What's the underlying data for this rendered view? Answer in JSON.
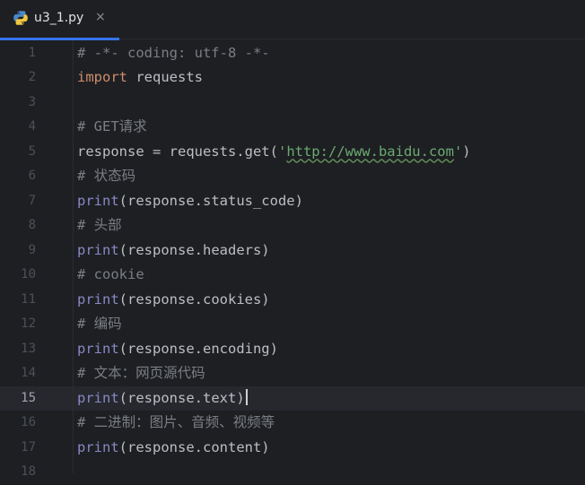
{
  "tab": {
    "label": "u3_1.py",
    "close": "×"
  },
  "editor": {
    "current_line": "15",
    "lines": [
      {
        "n": "1",
        "tokens": [
          {
            "t": "# -*- coding: utf-8 -*-",
            "k": "comment"
          }
        ]
      },
      {
        "n": "2",
        "tokens": [
          {
            "t": "import",
            "k": "keyword"
          },
          {
            "t": " requests",
            "k": "plain"
          }
        ]
      },
      {
        "n": "3",
        "tokens": []
      },
      {
        "n": "4",
        "tokens": [
          {
            "t": "# GET请求",
            "k": "comment"
          }
        ]
      },
      {
        "n": "5",
        "tokens": [
          {
            "t": "response = requests.get(",
            "k": "plain"
          },
          {
            "t": "'",
            "k": "string"
          },
          {
            "t": "http://www.baidu.com",
            "k": "url"
          },
          {
            "t": "'",
            "k": "string"
          },
          {
            "t": ")",
            "k": "plain"
          }
        ]
      },
      {
        "n": "6",
        "tokens": [
          {
            "t": "# 状态码",
            "k": "comment"
          }
        ]
      },
      {
        "n": "7",
        "tokens": [
          {
            "t": "print",
            "k": "builtin"
          },
          {
            "t": "(response.status_code)",
            "k": "plain"
          }
        ]
      },
      {
        "n": "8",
        "tokens": [
          {
            "t": "# 头部",
            "k": "comment"
          }
        ]
      },
      {
        "n": "9",
        "tokens": [
          {
            "t": "print",
            "k": "builtin"
          },
          {
            "t": "(response.headers)",
            "k": "plain"
          }
        ]
      },
      {
        "n": "10",
        "tokens": [
          {
            "t": "# cookie",
            "k": "comment"
          }
        ]
      },
      {
        "n": "11",
        "tokens": [
          {
            "t": "print",
            "k": "builtin"
          },
          {
            "t": "(response.cookies)",
            "k": "plain"
          }
        ]
      },
      {
        "n": "12",
        "tokens": [
          {
            "t": "# 编码",
            "k": "comment"
          }
        ]
      },
      {
        "n": "13",
        "tokens": [
          {
            "t": "print",
            "k": "builtin"
          },
          {
            "t": "(response.encoding)",
            "k": "plain"
          }
        ]
      },
      {
        "n": "14",
        "tokens": [
          {
            "t": "# 文本：网页源代码",
            "k": "comment"
          }
        ]
      },
      {
        "n": "15",
        "tokens": [
          {
            "t": "print",
            "k": "builtin"
          },
          {
            "t": "(response.text)",
            "k": "plain"
          }
        ]
      },
      {
        "n": "16",
        "tokens": [
          {
            "t": "# 二进制：图片、音频、视频等",
            "k": "comment"
          }
        ]
      },
      {
        "n": "17",
        "tokens": [
          {
            "t": "print",
            "k": "builtin"
          },
          {
            "t": "(response.content)",
            "k": "plain"
          }
        ]
      },
      {
        "n": "18",
        "tokens": []
      }
    ]
  },
  "colors": {
    "background": "#1e1f22",
    "accent": "#3574f0",
    "comment": "#7a7e85",
    "keyword": "#cf8e6d",
    "builtin": "#8888c6",
    "string": "#6aab73"
  },
  "icons": {
    "tab_file": "python-file-icon",
    "tab_close": "close-icon"
  }
}
